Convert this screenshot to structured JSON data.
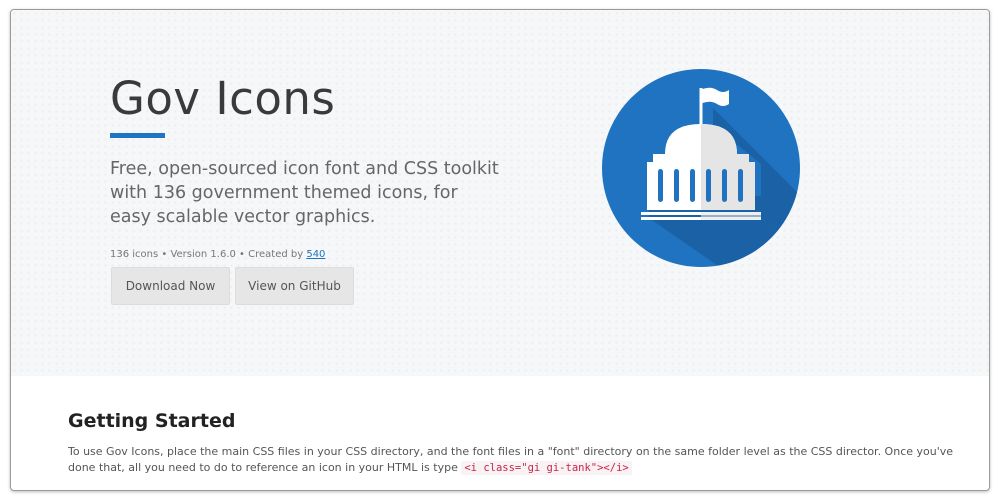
{
  "hero": {
    "title": "Gov Icons",
    "description": "Free, open-sourced icon font and CSS toolkit with 136 government themed icons, for easy scalable vector graphics.",
    "meta_prefix": "136 icons • Version 1.6.0 • Created by ",
    "meta_link": "540",
    "download_label": "Download Now",
    "github_label": "View on GitHub"
  },
  "logo": {
    "icon": "capitol-building-icon",
    "circle_color": "#1f73c1",
    "shadow_color": "#1a62a5",
    "building_color": "#ffffff"
  },
  "getting_started": {
    "title": "Getting Started",
    "text": "To use Gov Icons, place the main CSS files in your CSS directory, and the font files in a \"font\" directory on the same folder level as the CSS director. Once you've done that, all you need to do to reference an icon in your HTML is type ",
    "code": "<i class=\"gi gi-tank\"></i>"
  },
  "colors": {
    "accent": "#1f73c1",
    "code_text": "#c7254e"
  }
}
